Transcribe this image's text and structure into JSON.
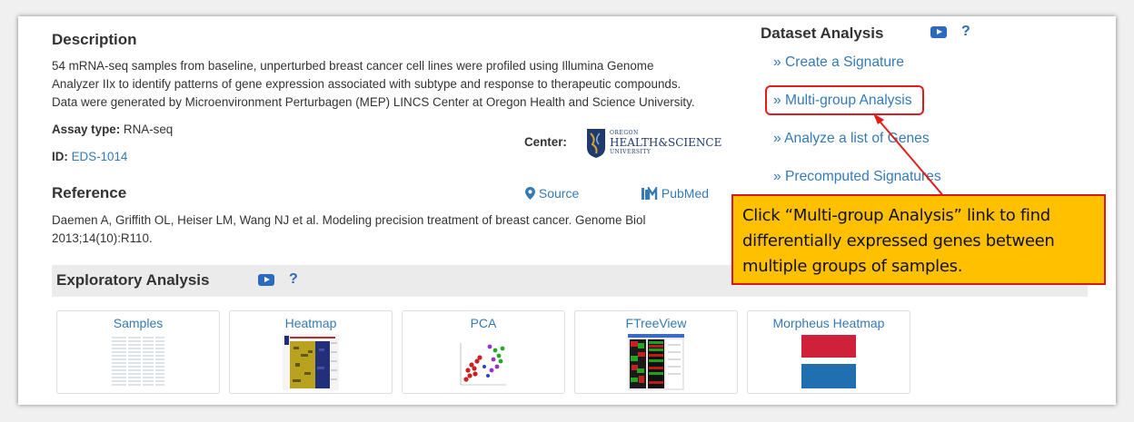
{
  "description": {
    "heading": "Description",
    "line1": "54 mRNA-seq samples from baseline, unperturbed breast cancer cell lines were profiled using Illumina Genome",
    "line2": "Analyzer IIx to identify patterns of gene expression associated with subtype and response to therapeutic compounds.",
    "line3": "Data were generated by Microenvironment Perturbagen (MEP) LINCS Center at Oregon Health and Science University."
  },
  "assay": {
    "label": "Assay type:",
    "value": "RNA-seq"
  },
  "id": {
    "label": "ID:",
    "value": "EDS-1014"
  },
  "center": {
    "label": "Center:",
    "logo_line1": "OREGON",
    "logo_line2": "HEALTH&SCIENCE",
    "logo_line3": "UNIVERSITY",
    "logo_badge": "OHSU"
  },
  "reference": {
    "heading": "Reference",
    "source_label": "Source",
    "pubmed_label": "PubMed",
    "line1": "Daemen A, Griffith OL, Heiser LM, Wang NJ et al. Modeling precision treatment of breast cancer. Genome Biol",
    "line2": "2013;14(10):R110."
  },
  "dataset_analysis": {
    "heading": "Dataset Analysis",
    "help": "?",
    "links": [
      "» Create a Signature",
      "» Multi-group Analysis",
      "» Analyze a list of Genes",
      "» Precomputed Signatures"
    ]
  },
  "exploratory": {
    "heading": "Exploratory Analysis",
    "help": "?",
    "cards": [
      "Samples",
      "Heatmap",
      "PCA",
      "FTreeView",
      "Morpheus Heatmap"
    ]
  },
  "callout": {
    "text": "Click “Multi-group Analysis” link to find differentially expressed genes between multiple groups of samples."
  },
  "colors": {
    "link": "#337ab7",
    "callout_bg": "#ffc000",
    "highlight": "#e31b1b",
    "morpheus_red": "#d0213b",
    "morpheus_blue": "#1f6fb1"
  }
}
